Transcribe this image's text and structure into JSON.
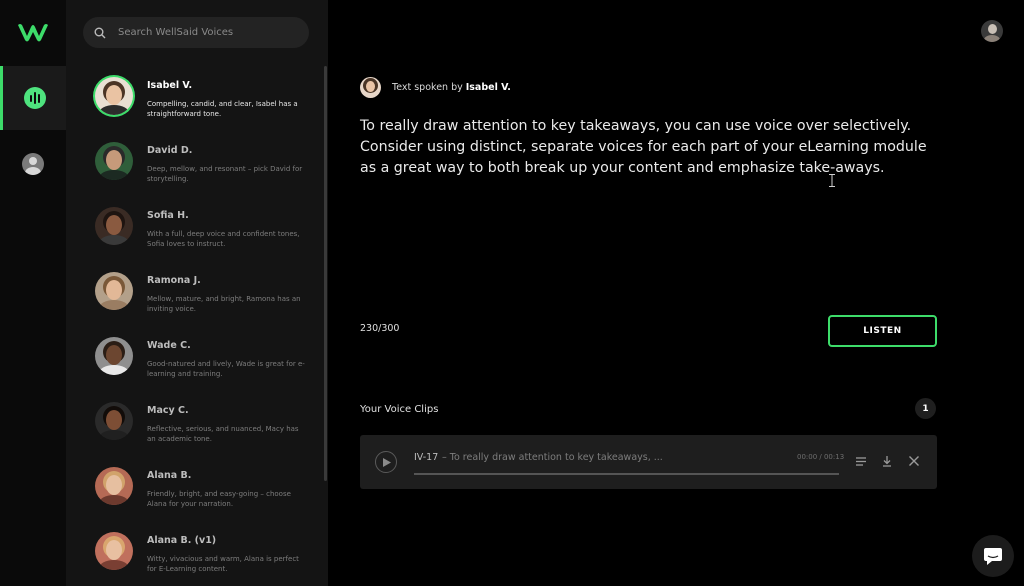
{
  "search": {
    "placeholder": "Search WellSaid Voices"
  },
  "voices": [
    {
      "name": "Isabel V.",
      "description": "Compelling, candid, and clear, Isabel has a straightforward tone.",
      "selected": true
    },
    {
      "name": "David D.",
      "description": "Deep, mellow, and resonant – pick David for storytelling."
    },
    {
      "name": "Sofia H.",
      "description": "With a full, deep voice and confident tones, Sofia loves to instruct."
    },
    {
      "name": "Ramona J.",
      "description": "Mellow, mature, and bright, Ramona has an inviting voice."
    },
    {
      "name": "Wade C.",
      "description": "Good-natured and lively, Wade is great for e-learning and training."
    },
    {
      "name": "Macy C.",
      "description": "Reflective, serious, and nuanced, Macy has an academic tone."
    },
    {
      "name": "Alana B.",
      "description": "Friendly, bright, and easy-going – choose Alana for your narration."
    },
    {
      "name": "Alana B. (v1)",
      "description": "Witty, vivacious and warm, Alana is perfect for E-Learning content."
    }
  ],
  "editor": {
    "spoken_by_label": "Text spoken by",
    "speaker_name": "Isabel V.",
    "text": "To really draw attention to key takeaways, you can use voice over selectively. Consider using distinct, separate voices for each part of your eLearning module as a great way to both break up your content and emphasize take-aways.",
    "char_count": "230/300",
    "listen_label": "LISTEN"
  },
  "clips": {
    "title": "Your Voice Clips",
    "count": "1",
    "items": [
      {
        "id": "IV-17",
        "preview": "– To really draw attention to key takeaways, ...",
        "time": "00:00 / 00:13",
        "progress": 0
      }
    ]
  },
  "colors": {
    "accent": "#3ddc6a",
    "background": "#000000",
    "panel": "#141414"
  }
}
